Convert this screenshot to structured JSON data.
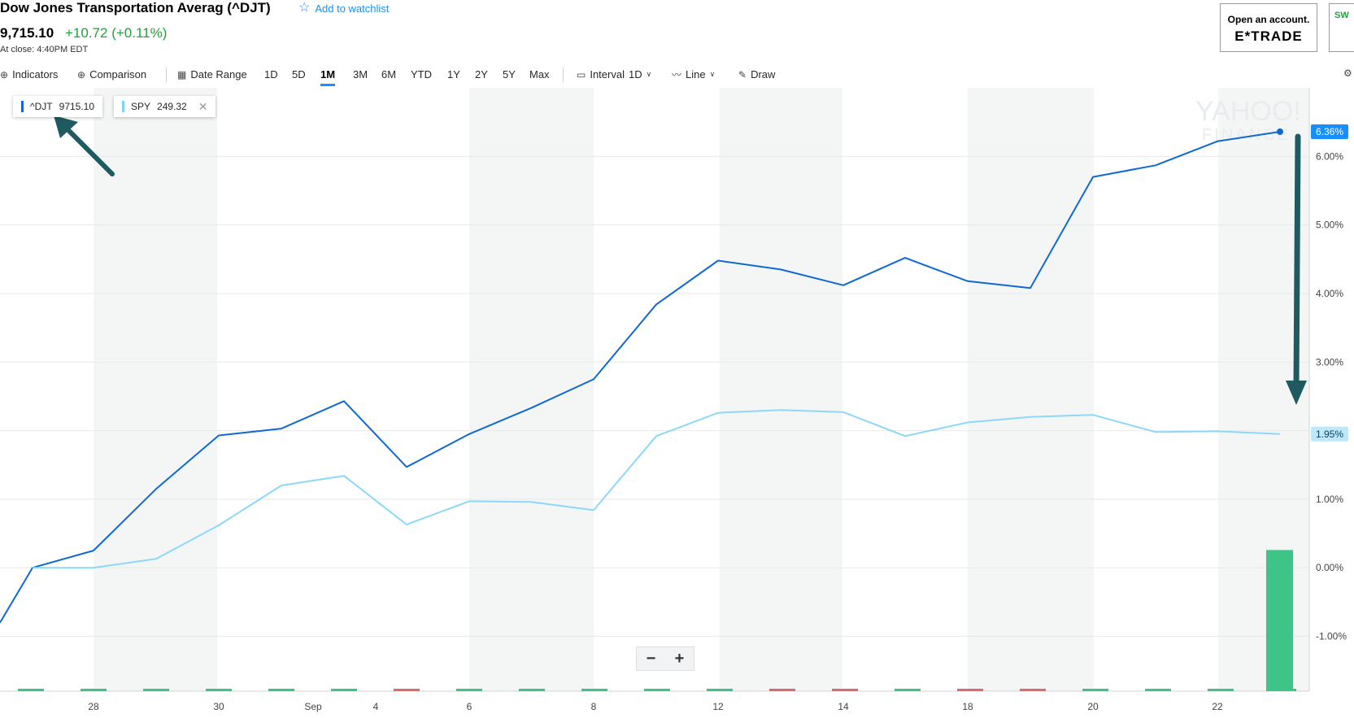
{
  "header": {
    "title": "Dow Jones Transportation Averag (^DJT)",
    "watchlist_label": "Add to watchlist",
    "price": "9,715.10",
    "change": "+10.72 (+0.11%)",
    "at_close": "At close: 4:40PM EDT"
  },
  "ad": {
    "line1": "Open an account.",
    "line2": "E*TRADE",
    "side_text": "SW"
  },
  "toolbar": {
    "indicators": "Indicators",
    "comparison": "Comparison",
    "date_range": "Date Range",
    "ranges": [
      "1D",
      "5D",
      "1M",
      "3M",
      "6M",
      "YTD",
      "1Y",
      "2Y",
      "5Y",
      "Max"
    ],
    "active_range": "1M",
    "interval_label": "Interval",
    "interval_value": "1D",
    "chart_type": "Line",
    "draw": "Draw"
  },
  "legend": [
    {
      "symbol": "^DJT",
      "value": "9715.10",
      "color": "#0f69d1"
    },
    {
      "symbol": "SPY",
      "value": "249.32",
      "color": "#7fd3f7"
    }
  ],
  "zoom": {
    "minus": "−",
    "plus": "+"
  },
  "colors": {
    "djt": "#0f69d1",
    "spy": "#8dd8f8",
    "up": "#3fc487",
    "down": "#e06a6a",
    "badge_djt": "#188fff",
    "badge_spy": "#bde8fb"
  },
  "chart_data": {
    "type": "line",
    "watermark": "YAHOO! FINANCE",
    "x": [
      "8/24",
      "8/27",
      "8/28",
      "8/29",
      "8/30",
      "8/31",
      "9/4",
      "9/5",
      "9/6",
      "9/7",
      "9/10",
      "9/11",
      "9/12",
      "9/13",
      "9/14",
      "9/17",
      "9/18",
      "9/19",
      "9/20",
      "9/21",
      "9/24"
    ],
    "series": [
      {
        "name": "^DJT",
        "values": [
          -0.8,
          0.0,
          0.25,
          1.15,
          1.93,
          2.03,
          2.43,
          1.47,
          1.95,
          2.33,
          2.75,
          3.84,
          4.48,
          4.35,
          4.12,
          4.52,
          4.18,
          4.08,
          5.7,
          5.87,
          6.22,
          6.36
        ],
        "badge": "6.36%"
      },
      {
        "name": "SPY",
        "values": [
          null,
          0.0,
          0.0,
          0.13,
          0.62,
          1.2,
          1.34,
          0.63,
          0.97,
          0.96,
          0.84,
          1.92,
          2.26,
          2.3,
          2.27,
          1.92,
          2.12,
          2.2,
          2.23,
          1.98,
          1.99,
          1.95
        ],
        "badge": "1.95%"
      }
    ],
    "ylim": [
      -1.8,
      7.0
    ],
    "yticks": [
      "-1.00%",
      "0.00%",
      "1.00%",
      "2.00%",
      "3.00%",
      "4.00%",
      "5.00%",
      "6.00%"
    ],
    "ytick_values": [
      -1,
      0,
      1,
      2,
      3,
      4,
      5,
      6
    ],
    "xticks": [
      "28",
      "30",
      "Sep",
      "4",
      "6",
      "8",
      "12",
      "14",
      "18",
      "20",
      "22"
    ],
    "volume_colors": [
      "up",
      "up",
      "up",
      "up",
      "up",
      "up",
      "down",
      "up",
      "up",
      "up",
      "up",
      "up",
      "down",
      "down",
      "up",
      "down",
      "down",
      "up",
      "up",
      "up",
      "up"
    ],
    "last_volume_fraction": 0.9
  }
}
